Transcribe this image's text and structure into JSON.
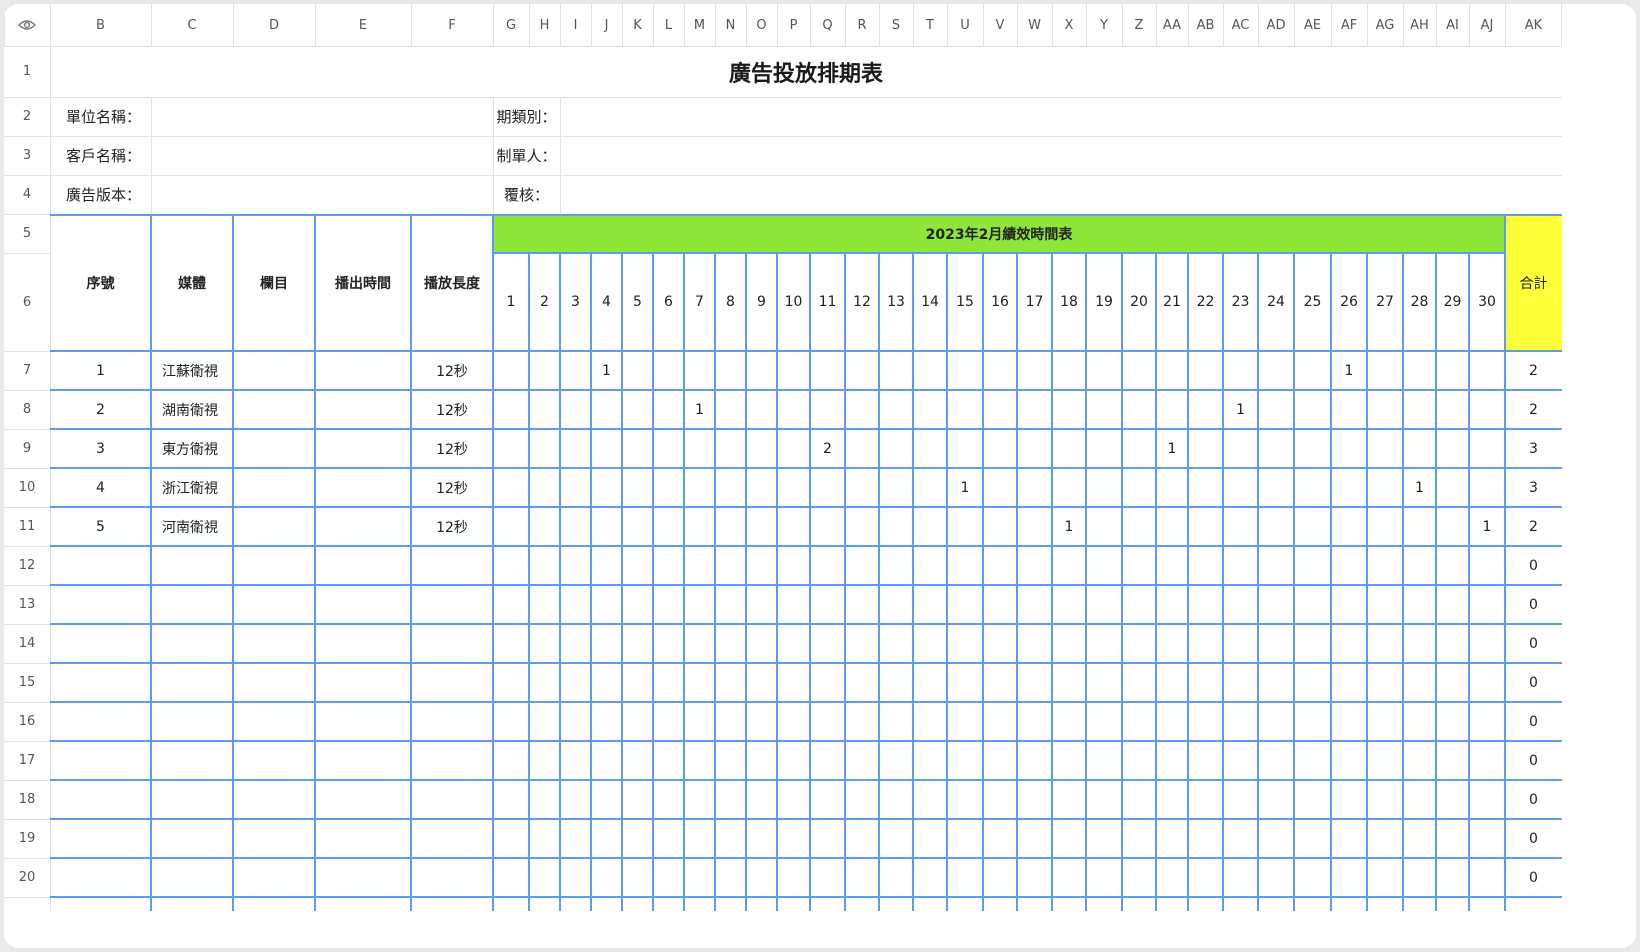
{
  "icons": {
    "corner": "eye-icon"
  },
  "colors": {
    "grid_blue": "#5b9cf0",
    "schedule_header": "#8fe53a",
    "total_header": "#ffff3a"
  },
  "column_letters": [
    "B",
    "C",
    "D",
    "E",
    "F",
    "G",
    "H",
    "I",
    "J",
    "K",
    "L",
    "M",
    "N",
    "O",
    "P",
    "Q",
    "R",
    "S",
    "T",
    "U",
    "V",
    "W",
    "X",
    "Y",
    "Z",
    "AA",
    "AB",
    "AC",
    "AD",
    "AE",
    "AF",
    "AG",
    "AH",
    "AI",
    "AJ",
    "AK"
  ],
  "row_numbers": [
    "1",
    "2",
    "3",
    "4",
    "5",
    "6",
    "7",
    "8",
    "9",
    "10",
    "11",
    "12",
    "13",
    "14",
    "15",
    "16",
    "17",
    "18",
    "19",
    "20"
  ],
  "sheet": {
    "title": "廣告投放排期表",
    "info": {
      "unit_name_label": "單位名稱：",
      "client_name_label": "客戶名稱：",
      "ad_version_label": "廣告版本：",
      "period_label": "期類別：",
      "author_label": "制單人：",
      "review_label": "覆核："
    },
    "headers": {
      "seq": "序號",
      "media": "媒體",
      "column": "欄目",
      "air_time": "播出時間",
      "duration": "播放長度",
      "schedule_title": "2023年2月績效時間表",
      "total": "合計"
    },
    "days": [
      "1",
      "2",
      "3",
      "4",
      "5",
      "6",
      "7",
      "8",
      "9",
      "10",
      "11",
      "12",
      "13",
      "14",
      "15",
      "16",
      "17",
      "18",
      "19",
      "20",
      "21",
      "22",
      "23",
      "24",
      "25",
      "26",
      "27",
      "28",
      "29",
      "30"
    ],
    "rows": [
      {
        "seq": "1",
        "media": "江蘇衛視",
        "column": "",
        "air_time": "",
        "duration": "12秒",
        "plays": {
          "4": "1",
          "26": "1"
        },
        "total": "2"
      },
      {
        "seq": "2",
        "media": "湖南衛視",
        "column": "",
        "air_time": "",
        "duration": "12秒",
        "plays": {
          "7": "1",
          "23": "1"
        },
        "total": "2"
      },
      {
        "seq": "3",
        "media": "東方衛視",
        "column": "",
        "air_time": "",
        "duration": "12秒",
        "plays": {
          "11": "2",
          "21": "1"
        },
        "total": "3"
      },
      {
        "seq": "4",
        "media": "浙江衛視",
        "column": "",
        "air_time": "",
        "duration": "12秒",
        "plays": {
          "15": "1",
          "28": "1"
        },
        "total": "3"
      },
      {
        "seq": "5",
        "media": "河南衛視",
        "column": "",
        "air_time": "",
        "duration": "12秒",
        "plays": {
          "18": "1",
          "30": "1"
        },
        "total": "2"
      },
      {
        "seq": "",
        "media": "",
        "column": "",
        "air_time": "",
        "duration": "",
        "plays": {},
        "total": "0"
      },
      {
        "seq": "",
        "media": "",
        "column": "",
        "air_time": "",
        "duration": "",
        "plays": {},
        "total": "0"
      },
      {
        "seq": "",
        "media": "",
        "column": "",
        "air_time": "",
        "duration": "",
        "plays": {},
        "total": "0"
      },
      {
        "seq": "",
        "media": "",
        "column": "",
        "air_time": "",
        "duration": "",
        "plays": {},
        "total": "0"
      },
      {
        "seq": "",
        "media": "",
        "column": "",
        "air_time": "",
        "duration": "",
        "plays": {},
        "total": "0"
      },
      {
        "seq": "",
        "media": "",
        "column": "",
        "air_time": "",
        "duration": "",
        "plays": {},
        "total": "0"
      },
      {
        "seq": "",
        "media": "",
        "column": "",
        "air_time": "",
        "duration": "",
        "plays": {},
        "total": "0"
      },
      {
        "seq": "",
        "media": "",
        "column": "",
        "air_time": "",
        "duration": "",
        "plays": {},
        "total": "0"
      },
      {
        "seq": "",
        "media": "",
        "column": "",
        "air_time": "",
        "duration": "",
        "plays": {},
        "total": "0"
      }
    ]
  }
}
